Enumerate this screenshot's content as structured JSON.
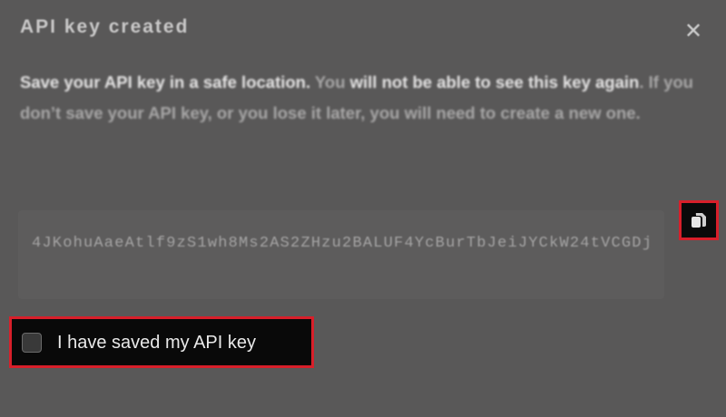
{
  "dialog": {
    "title": "API key created",
    "close_icon": "close-icon",
    "warning": {
      "part1": "Save your API key in a safe location.",
      "part2": " You ",
      "part3": "will not be able to see this key again",
      "part4": ". If you don’t save your API key, or you lose it later, you will need to create a new one."
    },
    "api_key": "4JKohuAaeAtlf9zS1wh8Ms2AS2ZHzu2BALUF4YcBurTbJeiJYCkW24tVCGDj",
    "copy_icon": "copy-icon",
    "confirm_label": "I have saved my API key",
    "confirm_checked": false
  },
  "colors": {
    "highlight": "#d81f2a",
    "background": "#595858"
  }
}
